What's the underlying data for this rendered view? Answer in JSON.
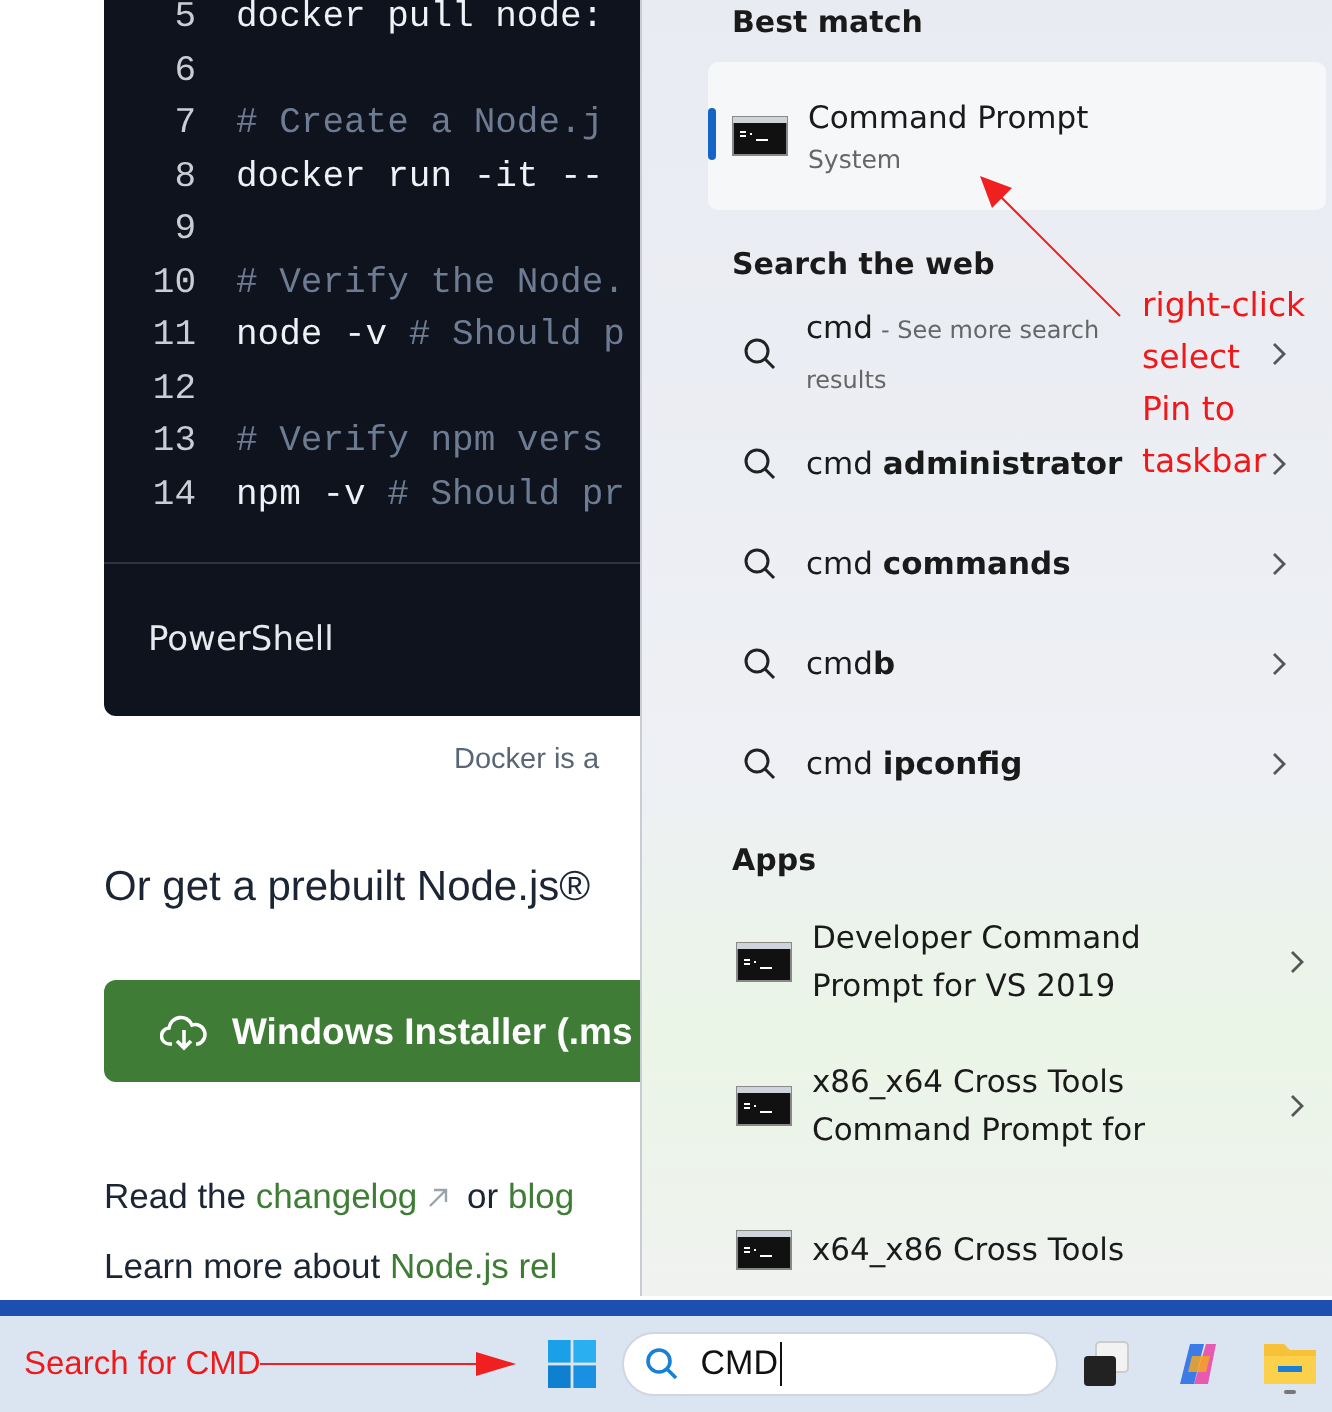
{
  "code_block": {
    "lines": [
      {
        "number": "5",
        "tokens": [
          {
            "kind": "code",
            "text": "docker pull node:"
          }
        ]
      },
      {
        "number": "6"
      },
      {
        "number": "7",
        "tokens": [
          {
            "kind": "comment",
            "text": "# Create a Node.j"
          }
        ]
      },
      {
        "number": "8",
        "tokens": [
          {
            "kind": "code",
            "text": "docker run -it --"
          }
        ]
      },
      {
        "number": "9"
      },
      {
        "number": "10",
        "tokens": [
          {
            "kind": "comment",
            "text": "# Verify the Node."
          }
        ]
      },
      {
        "number": "11",
        "tokens": [
          {
            "kind": "code",
            "text": "node -v "
          },
          {
            "kind": "comment",
            "text": "# Should p"
          }
        ]
      },
      {
        "number": "12"
      },
      {
        "number": "13",
        "tokens": [
          {
            "kind": "comment",
            "text": "# Verify npm vers"
          }
        ]
      },
      {
        "number": "14",
        "tokens": [
          {
            "kind": "code",
            "text": "npm -v "
          },
          {
            "kind": "comment",
            "text": "# Should pr"
          }
        ]
      }
    ],
    "language": "PowerShell"
  },
  "caption": "Docker is a",
  "heading": "Or get a prebuilt Node.js®",
  "download_button": {
    "label": "Windows Installer (.ms"
  },
  "links_line": [
    {
      "kind": "text",
      "text": "Read the "
    },
    {
      "kind": "external_link",
      "text": "changelog"
    },
    {
      "kind": "text",
      "text": " or "
    },
    {
      "kind": "link",
      "text": "blog"
    }
  ],
  "more_line": [
    {
      "kind": "text",
      "text": "Learn more about "
    },
    {
      "kind": "link",
      "text": "Node.js rel"
    }
  ],
  "search_flyout": {
    "best_match": {
      "heading": "Best match",
      "title": "Command Prompt",
      "subtitle": "System",
      "selected": true
    },
    "web": {
      "heading": "Search the web",
      "results": [
        {
          "text": "cmd",
          "hint": "- See more search results"
        },
        {
          "text": "cmd **administrator**"
        },
        {
          "text": "cmd **commands**"
        },
        {
          "text": "cmd**b**"
        },
        {
          "text": "cmd **ipconfig**"
        }
      ]
    },
    "apps": {
      "heading": "Apps",
      "items": [
        {
          "lines": [
            "Developer Command",
            "Prompt for VS 2019"
          ]
        },
        {
          "lines": [
            "x86_x64 Cross Tools",
            "Command Prompt for"
          ]
        },
        {
          "lines": [
            "x64_x86 Cross Tools"
          ]
        }
      ]
    }
  },
  "callout": {
    "lines": [
      "right-click",
      "select",
      "Pin to",
      "taskbar"
    ]
  },
  "taskbar": {
    "annotation": "Search for CMD",
    "search": {
      "value": "CMD"
    }
  }
}
